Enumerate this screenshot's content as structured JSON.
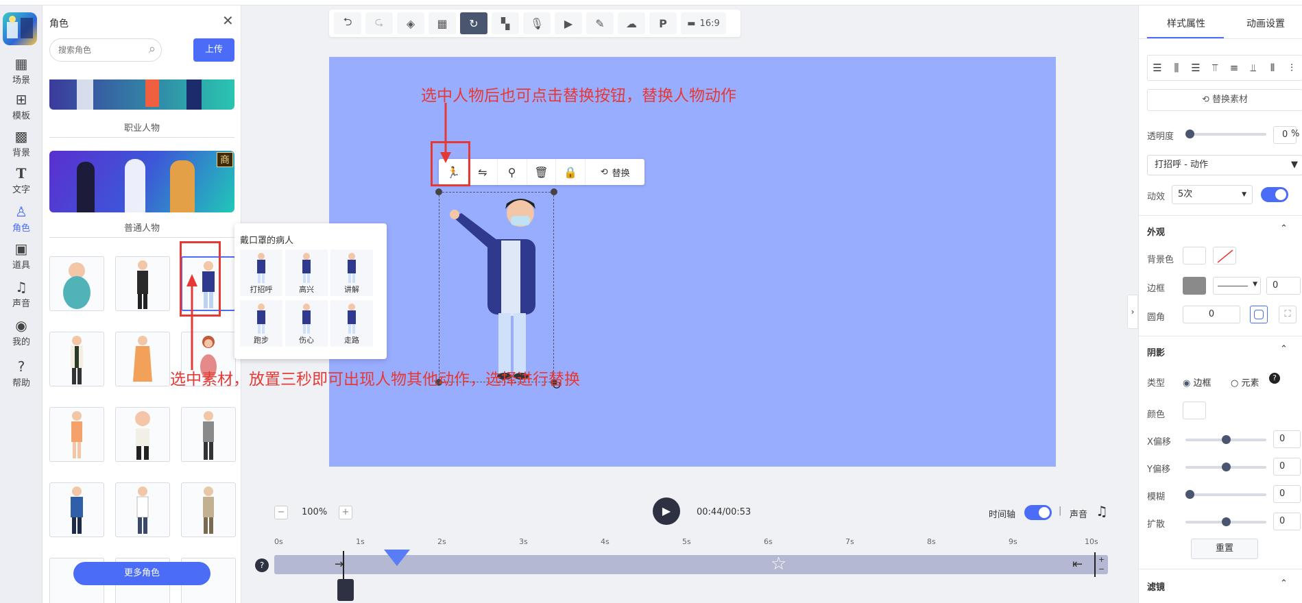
{
  "rail": {
    "items": [
      {
        "label": "场景",
        "icon": "grid-icon"
      },
      {
        "label": "模板",
        "icon": "template-icon"
      },
      {
        "label": "背景",
        "icon": "checker-icon"
      },
      {
        "label": "文字",
        "icon": "text-icon"
      },
      {
        "label": "角色",
        "icon": "user-icon"
      },
      {
        "label": "道具",
        "icon": "box-icon"
      },
      {
        "label": "声音",
        "icon": "music-icon"
      },
      {
        "label": "我的",
        "icon": "profile-icon"
      },
      {
        "label": "帮助",
        "icon": "help-icon"
      }
    ]
  },
  "panel": {
    "title": "角色",
    "search_placeholder": "搜索角色",
    "upload_label": "上传",
    "section_pro": "职业人物",
    "commercial_badge": "商",
    "section_common": "普通人物",
    "more_label": "更多角色"
  },
  "popup": {
    "title": "戴口罩的病人",
    "actions": [
      "打招呼",
      "高兴",
      "讲解",
      "跑步",
      "伤心",
      "走路"
    ]
  },
  "toolbar": {
    "ratio_label": "16:9"
  },
  "selection": {
    "replace_label": "替换"
  },
  "annotations": {
    "top": "选中人物后也可点击替换按钮，替换人物动作",
    "bottom": "选中素材，放置三秒即可出现人物其他动作，选择进行替换"
  },
  "playback": {
    "zoom": "100%",
    "time": "00:44/00:53",
    "timeline_label": "时间轴",
    "sound_label": "声音",
    "ticks": [
      "0s",
      "1s",
      "2s",
      "3s",
      "4s",
      "5s",
      "6s",
      "7s",
      "8s",
      "9s",
      "10s"
    ]
  },
  "right": {
    "tab_style": "样式属性",
    "tab_anim": "动画设置",
    "replace_material": "替换素材",
    "opacity_label": "透明度",
    "opacity_value": "0",
    "opacity_unit": "%",
    "action_select": "打招呼 - 动作",
    "effect_label": "动效",
    "effect_value": "5次",
    "appearance_title": "外观",
    "bg_label": "背景色",
    "border_label": "边框",
    "border_value": "0",
    "radius_label": "圆角",
    "radius_value": "0",
    "shadow_title": "阴影",
    "type_label": "类型",
    "type_border": "边框",
    "type_element": "元素",
    "color_label": "颜色",
    "x_label": "X偏移",
    "x_value": "0",
    "y_label": "Y偏移",
    "y_value": "0",
    "blur_label": "模糊",
    "blur_value": "0",
    "spread_label": "扩散",
    "spread_value": "0",
    "reset_label": "重置",
    "filter_title": "滤镜"
  },
  "colors": {
    "accent": "#4a6cf7",
    "stage": "#99adff",
    "annotation": "#e53935"
  }
}
